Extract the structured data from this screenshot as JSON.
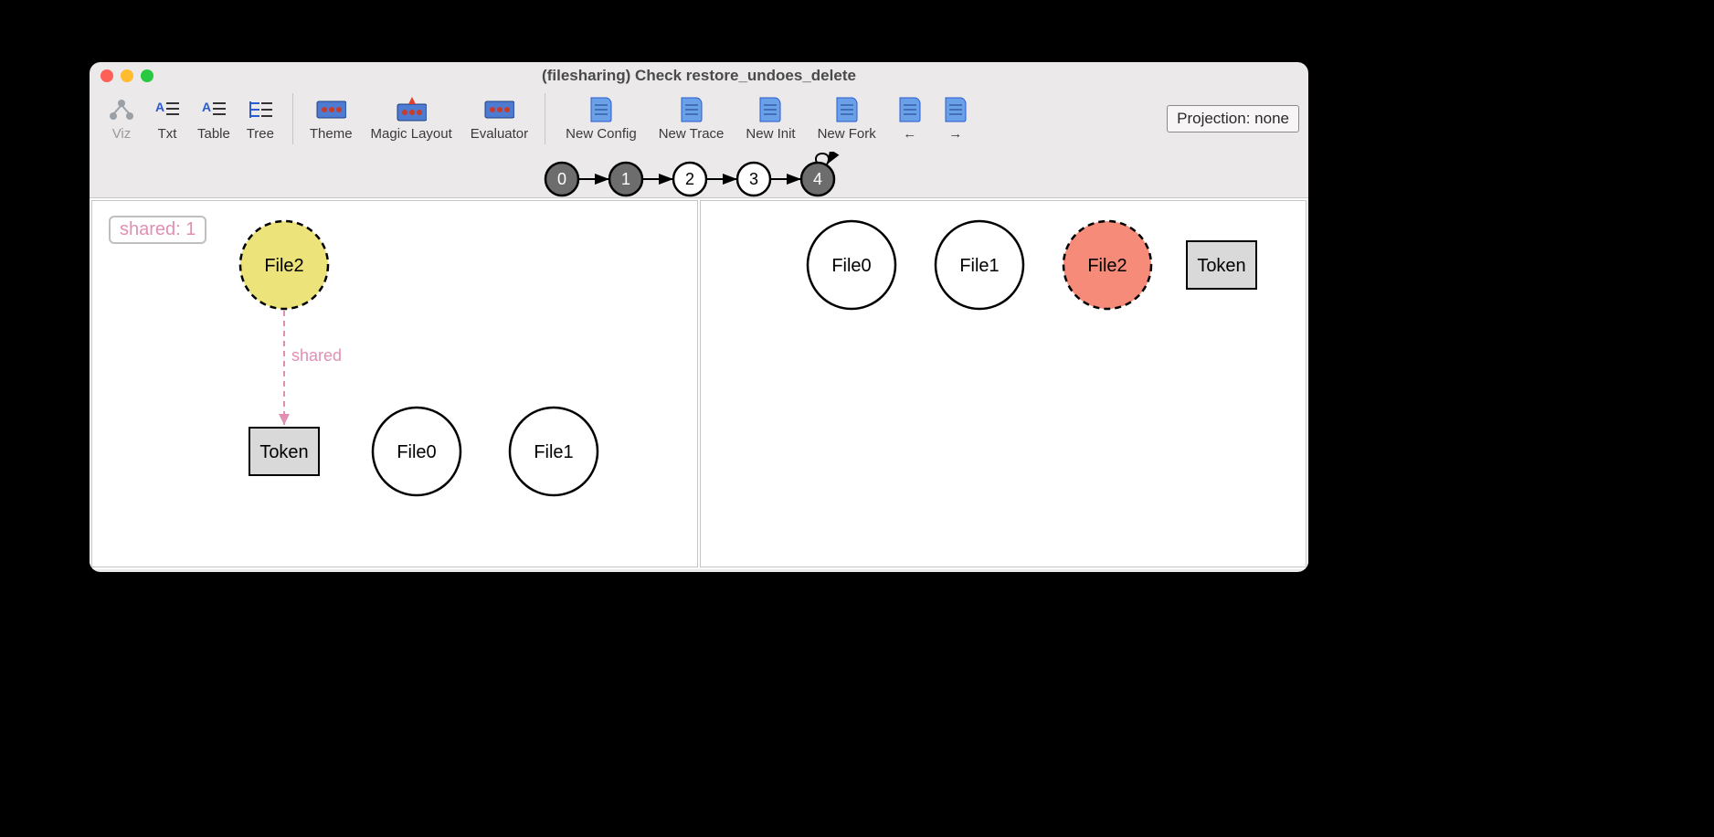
{
  "window_title": "(filesharing) Check restore_undoes_delete",
  "toolbar": {
    "viz": "Viz",
    "txt": "Txt",
    "table": "Table",
    "tree": "Tree",
    "theme": "Theme",
    "magic_layout": "Magic Layout",
    "evaluator": "Evaluator",
    "new_config": "New Config",
    "new_trace": "New Trace",
    "new_init": "New Init",
    "new_fork": "New Fork",
    "back": "←",
    "fwd": "→"
  },
  "projection_label": "Projection: none",
  "trace": {
    "steps": [
      "0",
      "1",
      "2",
      "3",
      "4"
    ],
    "active_indices": [
      0,
      1,
      4
    ]
  },
  "left": {
    "shared_label": "shared: 1",
    "file2": "File2",
    "edge_label": "shared",
    "token": "Token",
    "file0": "File0",
    "file1": "File1"
  },
  "right": {
    "file0": "File0",
    "file1": "File1",
    "file2": "File2",
    "token": "Token"
  }
}
